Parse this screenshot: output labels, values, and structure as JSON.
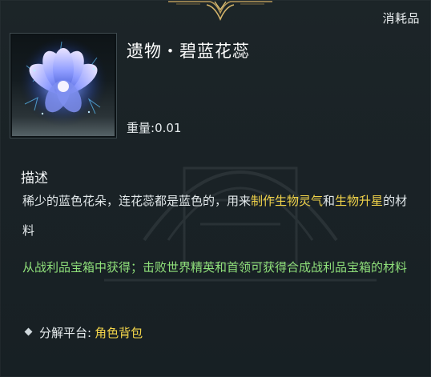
{
  "category": "消耗品",
  "item": {
    "title": "遗物・碧蓝花蕊",
    "icon": "blue-crystal-flower-icon",
    "weight_label": "重量:",
    "weight_value": "0.01"
  },
  "description": {
    "heading": "描述",
    "text_1": "稀少的蓝色花朵，连花蕊都是蓝色的，用来",
    "highlight_1": "制作生物灵气",
    "text_2": "和",
    "highlight_2": "生物升星",
    "text_3": "的材料"
  },
  "source_text": "从战利品宝箱中获得；击败世界精英和首领可获得合成战利品宝箱的材料",
  "decompose": {
    "label": "分解平台:",
    "value": "角色背包"
  },
  "colors": {
    "highlight": "#f2d44a",
    "source_green": "#8fe07a",
    "background": "#1a2226"
  }
}
